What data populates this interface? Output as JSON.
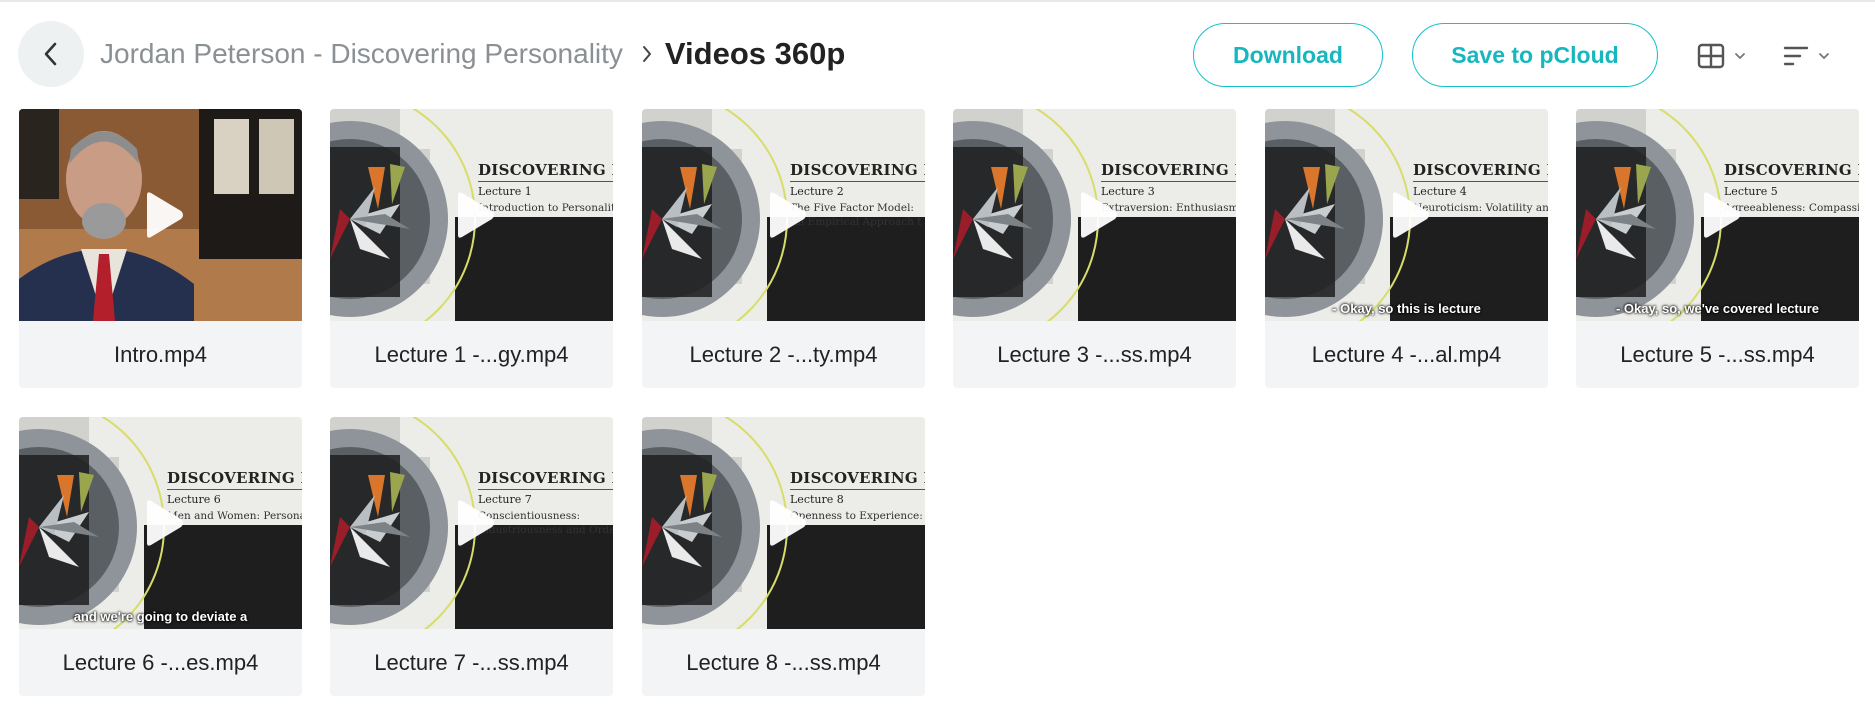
{
  "header": {
    "back_icon": "chevron-left-icon",
    "breadcrumb_parent": "Jordan Peterson - Discovering Personality",
    "breadcrumb_separator_icon": "chevron-right-icon",
    "breadcrumb_current": "Videos 360p",
    "download_label": "Download",
    "save_label": "Save to pCloud",
    "view_icon": "grid-view-icon",
    "sort_icon": "sort-icon"
  },
  "colors": {
    "accent": "#17c1c9",
    "card_bg": "#f3f4f5",
    "back_button_bg": "#eef1f2"
  },
  "files": [
    {
      "name": "Intro.mp4",
      "thumb": "person"
    },
    {
      "name": "Lecture 1 -...gy.mp4",
      "thumb": "slide",
      "slide_title": "DISCOVERING PE",
      "slide_lecture": "Lecture 1",
      "slide_sub": [
        "Introduction to Personality"
      ],
      "caption": ""
    },
    {
      "name": "Lecture 2 -...ty.mp4",
      "thumb": "slide",
      "slide_title": "DISCOVERING PE",
      "slide_lecture": "Lecture 2",
      "slide_sub": [
        "The Five Factor Model:",
        "An Empirical Approach t"
      ],
      "caption": ""
    },
    {
      "name": "Lecture 3 -...ss.mp4",
      "thumb": "slide",
      "slide_title": "DISCOVERING PE",
      "slide_lecture": "Lecture 3",
      "slide_sub": [
        "Extraversion: Enthusiasm"
      ],
      "caption": ""
    },
    {
      "name": "Lecture 4 -...al.mp4",
      "thumb": "slide",
      "slide_title": "DISCOVERING PE",
      "slide_lecture": "Lecture 4",
      "slide_sub": [
        "Neuroticism: Volatility and"
      ],
      "caption": "- Okay, so this is lecture"
    },
    {
      "name": "Lecture 5 -...ss.mp4",
      "thumb": "slide",
      "slide_title": "DISCOVERING PE",
      "slide_lecture": "Lecture 5",
      "slide_sub": [
        "Agreeableness: Compassio"
      ],
      "caption": "- Okay, so, we've covered lecture"
    },
    {
      "name": "Lecture 6 -...es.mp4",
      "thumb": "slide",
      "slide_title": "DISCOVERING PE",
      "slide_lecture": "Lecture 6",
      "slide_sub": [
        "Men and Women: Persona"
      ],
      "caption": "and we're going to deviate a"
    },
    {
      "name": "Lecture 7 -...ss.mp4",
      "thumb": "slide",
      "slide_title": "DISCOVERING PE",
      "slide_lecture": "Lecture 7",
      "slide_sub": [
        "Conscientiousness:",
        "Industriousness and Orde"
      ],
      "caption": ""
    },
    {
      "name": "Lecture 8 -...ss.mp4",
      "thumb": "slide",
      "slide_title": "DISCOVERING PER",
      "slide_lecture": "Lecture 8",
      "slide_sub": [
        "Openness to Experience: In"
      ],
      "caption": ""
    }
  ]
}
